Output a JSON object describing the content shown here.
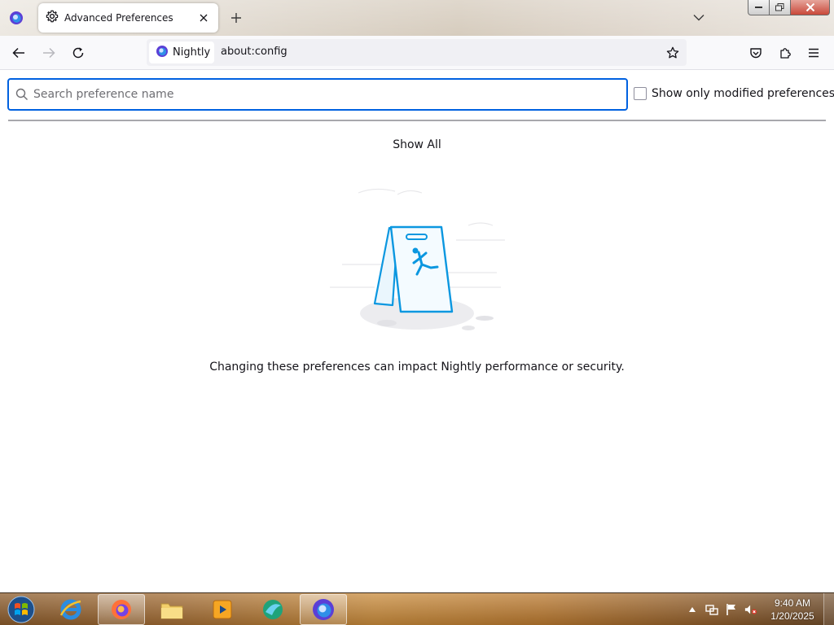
{
  "browser": {
    "tab": {
      "title": "Advanced Preferences",
      "icon": "gear-icon"
    },
    "identity_label": "Nightly",
    "url": "about:config"
  },
  "content": {
    "search": {
      "placeholder": "Search preference name",
      "value": ""
    },
    "modified_only": {
      "label": "Show only modified preferences",
      "checked": false
    },
    "show_all_label": "Show All",
    "warning_text": "Changing these preferences can impact Nightly performance or security."
  },
  "taskbar": {
    "apps": [
      "internet-explorer-icon",
      "firefox-icon",
      "file-explorer-icon",
      "media-player-icon",
      "browser-icon",
      "nightly-icon"
    ],
    "clock": {
      "time": "9:40 AM",
      "date": "1/20/2025"
    }
  },
  "colors": {
    "accent": "#0061e0",
    "illustration": "#0b97e0"
  }
}
